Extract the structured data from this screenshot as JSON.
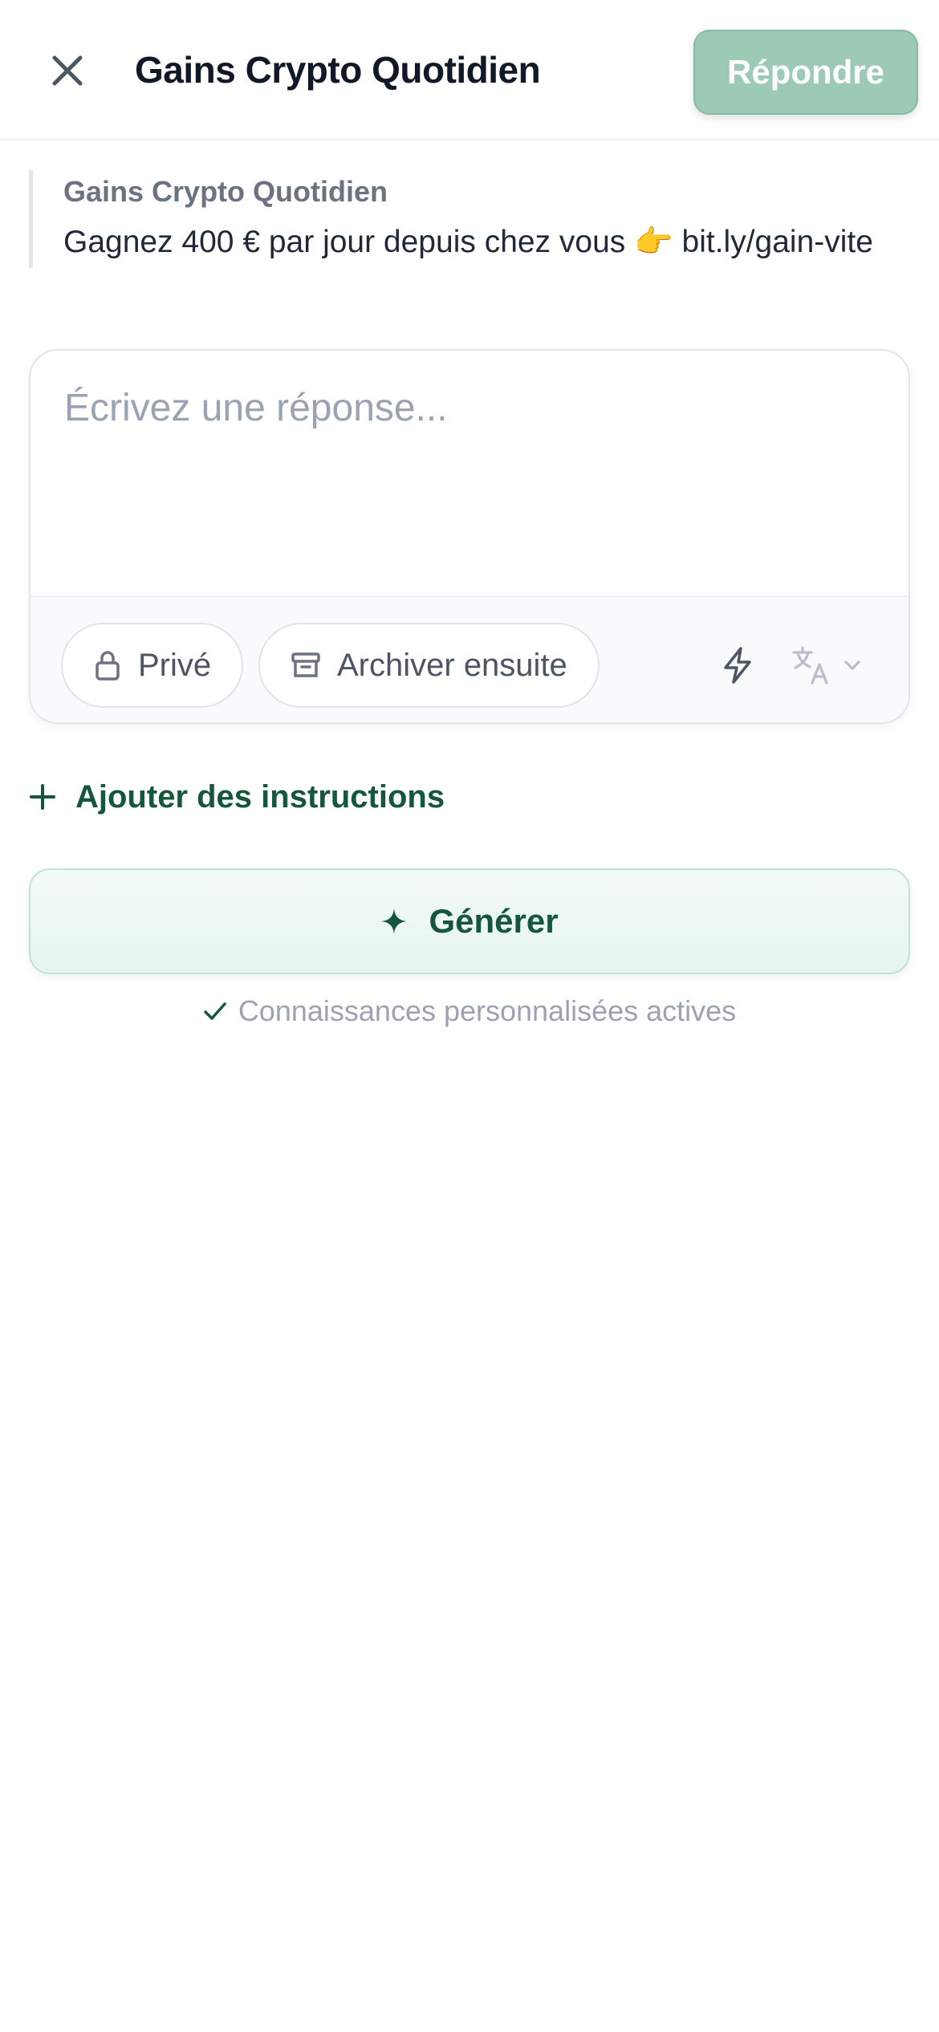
{
  "header": {
    "title": "Gains Crypto Quotidien",
    "reply_label": "Répondre",
    "close_icon": "close-icon"
  },
  "quoted_message": {
    "author": "Gains Crypto Quotidien",
    "text": "Gagnez 400 € par jour depuis chez vous 👉 bit.ly/gain-vite"
  },
  "composer": {
    "placeholder": "Écrivez une réponse...",
    "value": "",
    "chips": {
      "private_label": "Privé",
      "archive_label": "Archiver ensuite"
    },
    "icons": [
      "lock-icon",
      "archive-icon",
      "bolt-icon",
      "translate-icon",
      "chevron-down-icon"
    ]
  },
  "actions": {
    "add_instructions_label": "Ajouter des instructions",
    "generate_label": "Générer",
    "knowledge_status": "Connaissances personnalisées actives"
  },
  "colors": {
    "accent": "#14573a",
    "reply_button": "#9ccab4",
    "muted_text": "#9aa3b2"
  }
}
